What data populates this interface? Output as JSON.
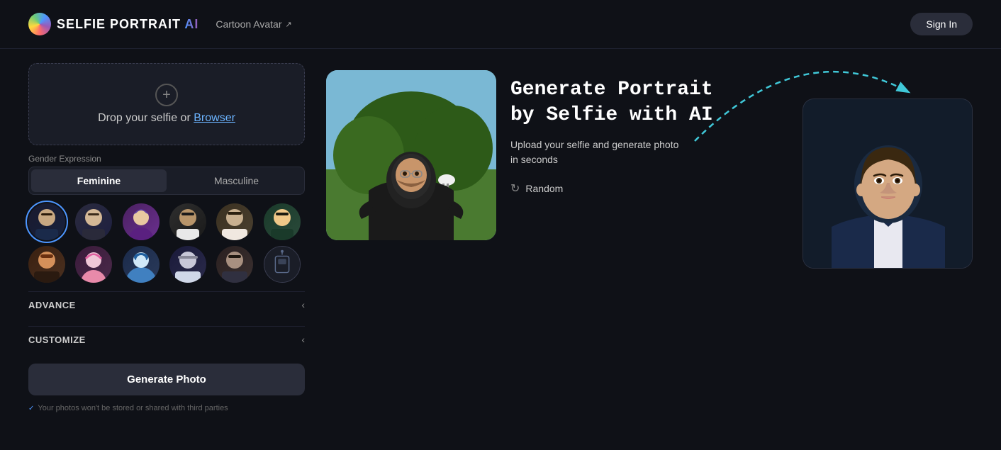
{
  "header": {
    "logo_selfie": "SELFIE",
    "logo_portrait": " PORTRAIT ",
    "logo_ai": "AI",
    "nav_cartoon": "Cartoon Avatar",
    "sign_in": "Sign In"
  },
  "upload": {
    "text": "Drop your selfie or ",
    "link_text": "Browser",
    "plus_icon": "+"
  },
  "gender": {
    "label": "Gender Expression",
    "feminine": "Feminine",
    "masculine": "Masculine"
  },
  "sections": {
    "advance": "ADVANCE",
    "customize": "CUSTOMIZE"
  },
  "generate": {
    "button": "Generate Photo",
    "privacy": "Your photos won't be stored or shared with third parties"
  },
  "hero": {
    "title": "Generate Portrait\nby Selfie with AI",
    "subtitle": "Upload your selfie and generate photo\nin seconds",
    "random": "Random"
  },
  "avatars": [
    {
      "id": 1,
      "selected": true
    },
    {
      "id": 2
    },
    {
      "id": 3
    },
    {
      "id": 4
    },
    {
      "id": 5
    },
    {
      "id": 6
    },
    {
      "id": 7
    },
    {
      "id": 8
    },
    {
      "id": 9
    },
    {
      "id": 10
    },
    {
      "id": 11
    },
    {
      "id": 12,
      "is3d": true
    }
  ]
}
